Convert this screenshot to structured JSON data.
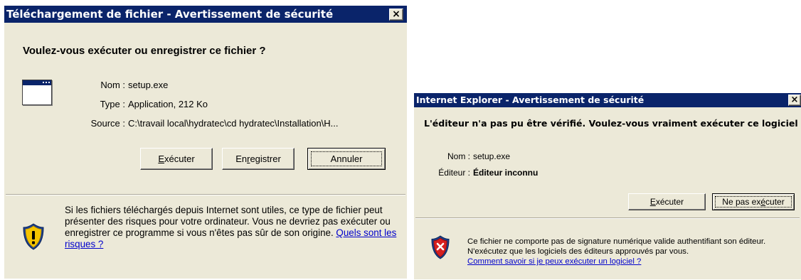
{
  "dialog1": {
    "title": "Téléchargement de fichier - Avertissement de sécurité",
    "close": "×",
    "heading": "Voulez-vous exécuter ou enregistrer ce fichier ?",
    "fields": [
      {
        "label": "Nom :",
        "value": "setup.exe"
      },
      {
        "label": "Type :",
        "value": "Application, 212 Ko"
      },
      {
        "label": "Source :",
        "value": "C:\\travail local\\hydratec\\cd hydratec\\Installation\\H..."
      }
    ],
    "buttons": {
      "run": {
        "pre": "",
        "key": "E",
        "post": "xécuter"
      },
      "save": {
        "pre": "En",
        "key": "r",
        "post": "egistrer"
      },
      "cancel": "Annuler"
    },
    "warning_text": "Si les fichiers téléchargés depuis Internet sont utiles, ce type de fichier peut présenter des risques pour votre ordinateur. Vous ne devriez pas exécuter ou enregistrer ce programme si vous n'êtes pas sûr de son origine.",
    "warning_link": "Quels sont les risques ?",
    "icon": "warning-shield-icon"
  },
  "dialog2": {
    "title": "Internet Explorer - Avertissement de sécurité",
    "close": "×",
    "heading": "L'éditeur n'a pas pu être vérifié. Voulez-vous vraiment exécuter ce logiciel ?",
    "fields": [
      {
        "label": "Nom :",
        "value": "setup.exe"
      },
      {
        "label": "Éditeur :",
        "value": "Éditeur inconnu"
      }
    ],
    "buttons": {
      "run": {
        "pre": "",
        "key": "E",
        "post": "xécuter"
      },
      "dont_run": {
        "pre": "Ne pas ex",
        "key": "é",
        "post": "cuter"
      }
    },
    "warning_text": "Ce fichier ne comporte pas de signature numérique valide authentifiant son éditeur. N'exécutez que les logiciels des éditeurs approuvés par vous.",
    "warning_link": "Comment savoir si je peux exécuter un logiciel ?",
    "icon": "error-shield-icon"
  }
}
